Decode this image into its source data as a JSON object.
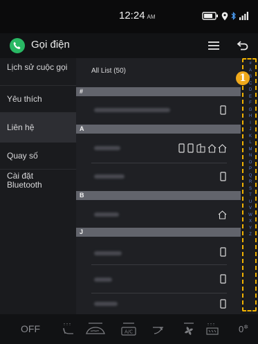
{
  "status_bar": {
    "time": "12:24",
    "ampm": "AM"
  },
  "app": {
    "title": "Gọi điện"
  },
  "sidebar": {
    "items": [
      {
        "label": "Lịch sử cuộc gọi"
      },
      {
        "label": "Yêu thích"
      },
      {
        "label": "Liên hệ",
        "active": true
      },
      {
        "label": "Quay số"
      },
      {
        "label": "Cài đặt Bluetooth"
      }
    ]
  },
  "contacts": {
    "header": "All List (50)",
    "sections": [
      "#",
      "A",
      "B",
      "J"
    ]
  },
  "alphabet": [
    "#",
    "A",
    "B",
    "C",
    "D",
    "E",
    "F",
    "G",
    "H",
    "I",
    "J",
    "K",
    "L",
    "M",
    "N",
    "O",
    "P",
    "Q",
    "R",
    "S",
    "T",
    "U",
    "V",
    "W",
    "X",
    "Y",
    "Z"
  ],
  "annotation": {
    "badge": "1",
    "color": "#f4b400"
  },
  "climate": {
    "off": "OFF",
    "temp": "0"
  },
  "colors": {
    "accent": "#29b864",
    "annotation": "#f0a91b",
    "index_letters": "#5c7fd4"
  }
}
